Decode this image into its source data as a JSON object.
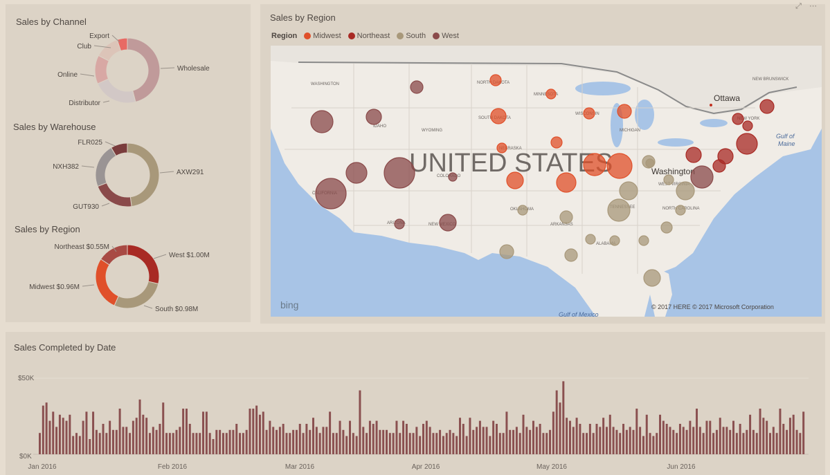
{
  "panels": {
    "channel": {
      "title": "Sales by Channel"
    },
    "warehouse": {
      "title": "Sales by Warehouse"
    },
    "region_donut": {
      "title": "Sales by Region"
    },
    "map": {
      "title": "Sales by Region"
    },
    "date": {
      "title": "Sales Completed by Date"
    }
  },
  "map": {
    "legend_title": "Region",
    "legend_items": [
      {
        "label": "Midwest",
        "color": "#e0502a"
      },
      {
        "label": "Northeast",
        "color": "#a82a24"
      },
      {
        "label": "South",
        "color": "#a8987a"
      },
      {
        "label": "West",
        "color": "#8a4a4a"
      }
    ],
    "country_label": "UNITED STATES",
    "ottawa": "Ottawa",
    "washington": "Washington",
    "gulf_maine": "Gulf of\nMaine",
    "gulf_mexico": "Gulf of Mexico",
    "bing": "bing",
    "copyright": "© 2017 HERE  © 2017 Microsoft Corporation",
    "corner_icons": "⤢ ⋯"
  },
  "chart_data": [
    {
      "type": "pie",
      "title": "Sales by Channel",
      "donut": true,
      "slices": [
        {
          "label": "Wholesale",
          "value": 45,
          "color": "#c09a9a"
        },
        {
          "label": "Distributor",
          "value": 22,
          "color": "#d2c8c6"
        },
        {
          "label": "Online",
          "value": 14,
          "color": "#d8a8a4"
        },
        {
          "label": "Club",
          "value": 12,
          "color": "#dcc4b8"
        },
        {
          "label": "Export",
          "value": 5,
          "color": "#e86a64"
        }
      ]
    },
    {
      "type": "pie",
      "title": "Sales by Warehouse",
      "donut": true,
      "slices": [
        {
          "label": "AXW291",
          "value": 45,
          "color": "#a8987a"
        },
        {
          "label": "GUT930",
          "value": 20,
          "color": "#8a4a4a"
        },
        {
          "label": "NXH382",
          "value": 21,
          "color": "#9a9494"
        },
        {
          "label": "FLR025",
          "value": 8,
          "color": "#7a3c3c"
        }
      ]
    },
    {
      "type": "pie",
      "title": "Sales by Region",
      "donut": true,
      "slices": [
        {
          "label": "West $1.00M",
          "value": 1.0,
          "color": "#a82a24"
        },
        {
          "label": "South $0.98M",
          "value": 0.98,
          "color": "#a8987a"
        },
        {
          "label": "Midwest $0.96M",
          "value": 0.96,
          "color": "#e0502a"
        },
        {
          "label": "Northeast $0.55M",
          "value": 0.55,
          "color": "#a84a44"
        }
      ]
    },
    {
      "type": "bar",
      "title": "Sales Completed by Date",
      "ylabel": "",
      "ylim": [
        0,
        50000
      ],
      "yticks": [
        "$0K",
        "$50K"
      ],
      "xticks": [
        "Jan 2016",
        "Feb 2016",
        "Mar 2016",
        "Apr 2016",
        "May 2016",
        "Jun 2016"
      ],
      "bar_color": "#8a5050",
      "values": [
        14,
        32,
        34,
        22,
        28,
        18,
        26,
        24,
        22,
        26,
        12,
        14,
        12,
        22,
        28,
        10,
        28,
        16,
        14,
        20,
        14,
        22,
        16,
        16,
        30,
        18,
        18,
        14,
        22,
        24,
        36,
        26,
        24,
        14,
        18,
        16,
        20,
        34,
        14,
        14,
        14,
        16,
        18,
        30,
        30,
        20,
        14,
        14,
        14,
        28,
        28,
        14,
        10,
        16,
        16,
        14,
        14,
        16,
        16,
        20,
        14,
        14,
        16,
        30,
        30,
        32,
        26,
        28,
        16,
        22,
        18,
        16,
        18,
        20,
        14,
        14,
        16,
        16,
        20,
        14,
        20,
        16,
        24,
        18,
        14,
        18,
        18,
        28,
        14,
        14,
        22,
        16,
        12,
        22,
        14,
        12,
        42,
        18,
        14,
        22,
        20,
        22,
        16,
        16,
        16,
        14,
        14,
        22,
        14,
        22,
        20,
        14,
        14,
        18,
        12,
        20,
        22,
        18,
        14,
        14,
        16,
        12,
        14,
        16,
        14,
        12,
        24,
        20,
        12,
        24,
        16,
        18,
        22,
        18,
        18,
        12,
        22,
        20,
        14,
        14,
        28,
        16,
        16,
        18,
        14,
        26,
        18,
        16,
        22,
        18,
        20,
        14,
        14,
        16,
        28,
        42,
        34,
        48,
        24,
        22,
        18,
        24,
        20,
        14,
        14,
        20,
        14,
        20,
        18,
        24,
        18,
        26,
        18,
        16,
        14,
        20,
        16,
        18,
        16,
        30,
        18,
        12,
        26,
        14,
        12,
        14,
        26,
        22,
        20,
        18,
        16,
        14,
        20,
        18,
        16,
        22,
        18,
        30,
        18,
        14,
        22,
        22,
        14,
        16,
        24,
        18,
        18,
        16,
        22,
        14,
        20,
        14,
        16,
        26,
        16,
        14,
        30,
        24,
        22,
        14,
        18,
        14,
        30,
        20,
        16,
        24,
        26,
        16,
        14,
        28
      ]
    }
  ]
}
